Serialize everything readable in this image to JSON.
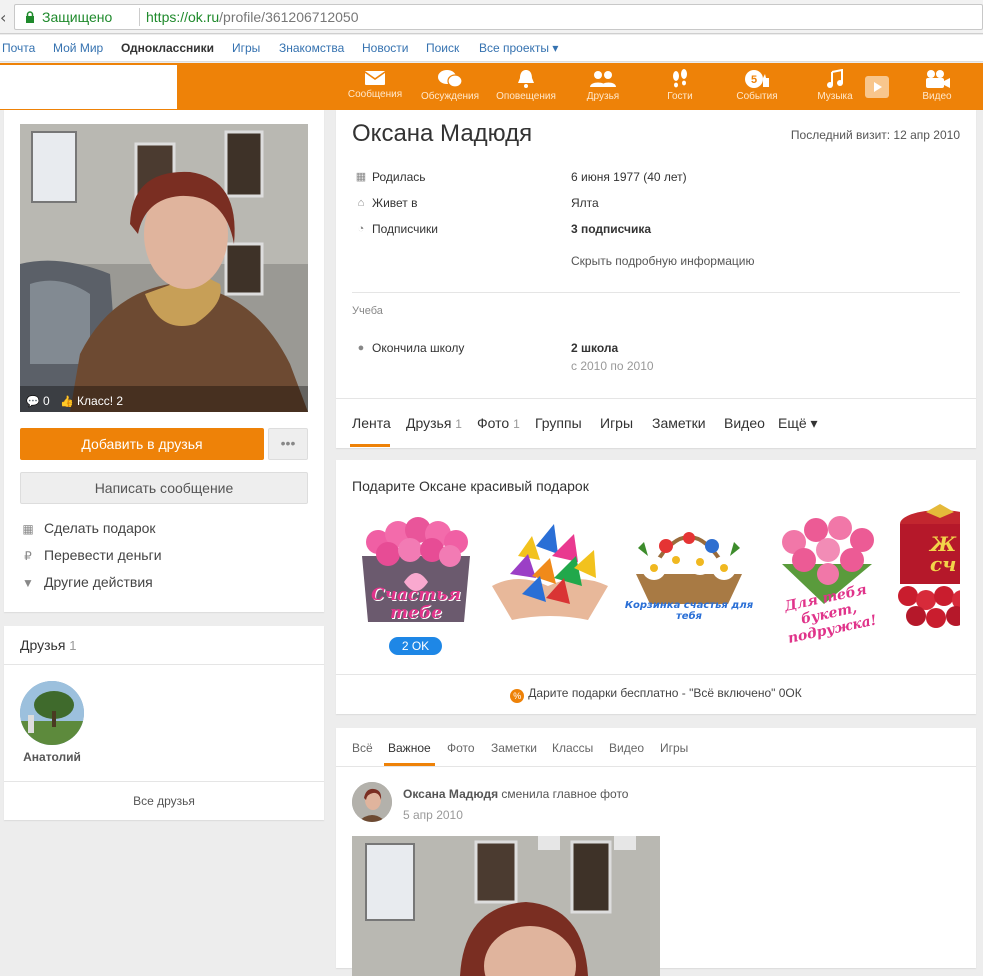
{
  "browser": {
    "secure_label": "Защищено",
    "url_main": "https://ok.ru",
    "url_path": "/profile/361206712050"
  },
  "portal_nav": [
    {
      "label": "Почта"
    },
    {
      "label": "Мой Мир"
    },
    {
      "label": "Одноклассники",
      "active": true
    },
    {
      "label": "Игры"
    },
    {
      "label": "Знакомства"
    },
    {
      "label": "Новости"
    },
    {
      "label": "Поиск"
    },
    {
      "label": "Все проекты ▾"
    }
  ],
  "toolbar": [
    {
      "label": "Сообщения",
      "icon": "envelope-icon"
    },
    {
      "label": "Обсуждения",
      "icon": "chat-bubbles-icon"
    },
    {
      "label": "Оповещения",
      "icon": "bell-icon"
    },
    {
      "label": "Друзья",
      "icon": "friends-icon"
    },
    {
      "label": "Гости",
      "icon": "footprints-icon"
    },
    {
      "label": "События",
      "icon": "events-icon",
      "badge": "5"
    },
    {
      "label": "Музыка",
      "icon": "music-note-icon"
    },
    {
      "label": "Видео",
      "icon": "video-camera-icon"
    }
  ],
  "profile": {
    "photo_comments": "0",
    "photo_likes": "Класс! 2",
    "add_friend": "Добавить в друзья",
    "more": "•••",
    "write_message": "Написать сообщение",
    "actions": [
      {
        "label": "Сделать подарок",
        "icon": "gift-icon"
      },
      {
        "label": "Перевести деньги",
        "icon": "ruble-icon"
      },
      {
        "label": "Другие действия",
        "icon": "triangle-down-icon"
      }
    ],
    "name": "Оксана Мадюдя",
    "last_visit": "Последний визит: 12 апр 2010",
    "info": [
      {
        "label": "Родилась",
        "value": "6 июня 1977 (40 лет)",
        "icon": "calendar-icon"
      },
      {
        "label": "Живет в",
        "value": "Ялта",
        "icon": "house-icon"
      },
      {
        "label": "Подписчики",
        "value": "3 подписчика",
        "icon": "rss-icon"
      }
    ],
    "hide_info": "Скрыть подробную информацию",
    "study_heading": "Учеба",
    "study": {
      "label": "Окончила школу",
      "value": "2 школа",
      "years": "с 2010 по 2010"
    }
  },
  "profile_tabs": [
    {
      "label": "Лента",
      "count": ""
    },
    {
      "label": "Друзья",
      "count": "1"
    },
    {
      "label": "Фото",
      "count": "1"
    },
    {
      "label": "Группы",
      "count": ""
    },
    {
      "label": "Игры",
      "count": ""
    },
    {
      "label": "Заметки",
      "count": ""
    },
    {
      "label": "Видео",
      "count": ""
    },
    {
      "label": "Ещё ▾",
      "count": ""
    }
  ],
  "friends_block": {
    "title": "Друзья",
    "count": "1",
    "friend_name": "Анатолий",
    "all_friends": "Все друзья"
  },
  "gifts": {
    "title": "Подарите Оксане красивый подарок",
    "price_badge": "2 OK",
    "gift_texts": [
      "Счастья тебе",
      "Корзинка счастья для тебя",
      "Для тебя букет, подружка!",
      "Ж сч"
    ],
    "footer": "Дарите подарки бесплатно - \"Всё включено\" 0ОК"
  },
  "feed": {
    "tabs": [
      "Всё",
      "Важное",
      "Фото",
      "Заметки",
      "Классы",
      "Видео",
      "Игры"
    ],
    "active_tab": "Важное",
    "post_author": "Оксана Мадюдя",
    "post_action": "сменила главное фото",
    "post_date": "5 апр 2010"
  },
  "colors": {
    "accent": "#ee8208",
    "link": "#3572b0"
  }
}
